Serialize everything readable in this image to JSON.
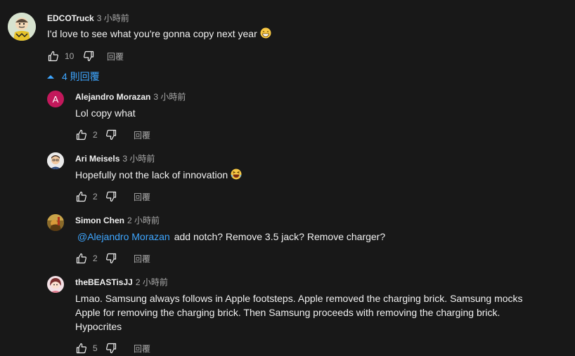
{
  "main_comment": {
    "author": "EDCOTruck",
    "time": "3 小時前",
    "text": "I'd love to see what you're gonna copy next year",
    "emoji": "grin-emoji",
    "likes": "10",
    "reply_label": "回覆"
  },
  "replies_toggle": {
    "label": "4 則回覆"
  },
  "replies": [
    {
      "author": "Alejandro Morazan",
      "time": "3 小時前",
      "text": "Lol copy what",
      "avatar_letter": "A",
      "avatar_color": "#c2185b",
      "likes": "2",
      "reply_label": "回覆"
    },
    {
      "author": "Ari Meisels",
      "time": "3 小時前",
      "text": "Hopefully not the lack of innovation",
      "emoji": "laughing-emoji",
      "likes": "2",
      "reply_label": "回覆"
    },
    {
      "author": "Simon Chen",
      "time": "2 小時前",
      "mention": "@Alejandro Morazan",
      "text": "add notch? Remove 3.5 jack? Remove charger?",
      "likes": "2",
      "reply_label": "回覆"
    },
    {
      "author": "theBEASTisJJ",
      "time": "2 小時前",
      "text_lines": [
        "Lmao. Samsung always follows in Apple footsteps. Apple removed the charging brick. Samsung mocks",
        "Apple for removing the charging brick. Then Samsung proceeds with removing the charging brick.",
        "Hypocrites"
      ],
      "likes": "5",
      "reply_label": "回覆"
    }
  ],
  "colors": {
    "background": "#181818",
    "text": "#f1f1f1",
    "secondary": "#aaaaaa",
    "link": "#3ea6ff"
  }
}
